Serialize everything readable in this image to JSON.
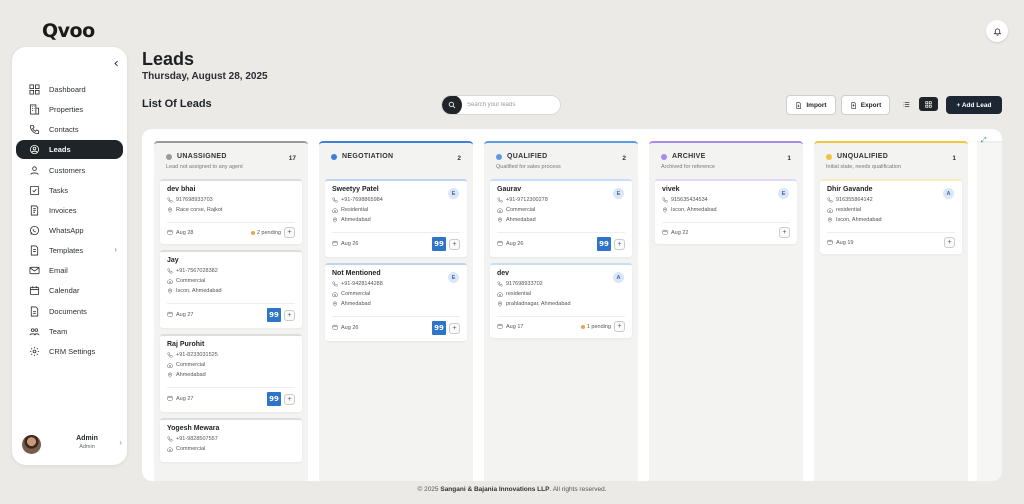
{
  "brand": {
    "logo": "Qvoo"
  },
  "sidebar": {
    "items": [
      {
        "label": "Dashboard",
        "icon": "dashboard-icon",
        "active": false
      },
      {
        "label": "Properties",
        "icon": "building-icon",
        "active": false
      },
      {
        "label": "Contacts",
        "icon": "phone-icon",
        "active": false
      },
      {
        "label": "Leads",
        "icon": "leads-icon",
        "active": true
      },
      {
        "label": "Customers",
        "icon": "user-icon",
        "active": false
      },
      {
        "label": "Tasks",
        "icon": "task-icon",
        "active": false
      },
      {
        "label": "Invoices",
        "icon": "invoice-icon",
        "active": false
      },
      {
        "label": "WhatsApp",
        "icon": "whatsapp-icon",
        "active": false
      },
      {
        "label": "Templates",
        "icon": "template-icon",
        "active": false
      },
      {
        "label": "Email",
        "icon": "email-icon",
        "active": false
      },
      {
        "label": "Calendar",
        "icon": "calendar-icon",
        "active": false
      },
      {
        "label": "Documents",
        "icon": "document-icon",
        "active": false
      },
      {
        "label": "Team",
        "icon": "team-icon",
        "active": false
      },
      {
        "label": "CRM Settings",
        "icon": "gear-icon",
        "active": false
      }
    ],
    "user": {
      "name": "Admin",
      "role": "Admin"
    }
  },
  "header": {
    "title": "Leads",
    "date": "Thursday, August 28, 2025",
    "list_title": "List Of Leads",
    "search_placeholder": "Search your leads",
    "import_label": "Import",
    "export_label": "Export",
    "add_label": "+ Add Lead"
  },
  "columns": [
    {
      "title": "UNASSIGNED",
      "count": "17",
      "desc": "Lead not assigned to any agent",
      "color": "#9a9a9a",
      "cards": [
        {
          "name": "dev bhai",
          "phone": "917698933703",
          "type": "",
          "location": "Race corse, Rajkot",
          "date": "Aug 28",
          "pending": "2 pending",
          "badge": "",
          "initial": ""
        },
        {
          "name": "Jay",
          "phone": "+91-7567028382",
          "type": "Commercial",
          "location": "Iscon, Ahmedabad",
          "date": "Aug 27",
          "pending": "",
          "badge": "99",
          "initial": ""
        },
        {
          "name": "Raj Purohit",
          "phone": "+91-8233031525",
          "type": "Commercial",
          "location": "Ahmedabad",
          "date": "Aug 27",
          "pending": "",
          "badge": "99",
          "initial": ""
        },
        {
          "name": "Yogesh Mewara",
          "phone": "+91-9828507557",
          "type": "Commercial",
          "location": "",
          "date": "",
          "pending": "",
          "badge": "",
          "initial": ""
        }
      ]
    },
    {
      "title": "NEGOTIATION",
      "count": "2",
      "desc": "",
      "color": "#3d7fd9",
      "cards": [
        {
          "name": "Sweetyy Patel",
          "phone": "+91-7698865984",
          "type": "Residential",
          "location": "Ahmedabad",
          "date": "Aug 26",
          "pending": "",
          "badge": "99",
          "initial": "E"
        },
        {
          "name": "Not Mentioned",
          "phone": "+91-9428144288",
          "type": "Commercial",
          "location": "Ahmedabad",
          "date": "Aug 26",
          "pending": "",
          "badge": "99",
          "initial": "E"
        }
      ]
    },
    {
      "title": "QUALIFIED",
      "count": "2",
      "desc": "Qualified for sales process",
      "color": "#5b9be6",
      "cards": [
        {
          "name": "Gaurav",
          "phone": "+91-9712300278",
          "type": "Commercial",
          "location": "Ahmedabad",
          "date": "Aug 26",
          "pending": "",
          "badge": "99",
          "initial": "E"
        },
        {
          "name": "dev",
          "phone": "917698933702",
          "type": "residential",
          "location": "prahladnagar, Ahmedabad",
          "date": "Aug 17",
          "pending": "1 pending",
          "badge": "",
          "initial": "A"
        }
      ]
    },
    {
      "title": "ARCHIVE",
      "count": "1",
      "desc": "Archived for reference",
      "color": "#a78be8",
      "cards": [
        {
          "name": "vivek",
          "phone": "915635434534",
          "type": "",
          "location": "Iscon, Ahmedabad",
          "date": "Aug 22",
          "pending": "",
          "badge": "",
          "initial": "E"
        }
      ]
    },
    {
      "title": "UNQUALIFIED",
      "count": "1",
      "desc": "Initial state, needs qualification",
      "color": "#f2c53a",
      "cards": [
        {
          "name": "Dhir Gavande",
          "phone": "916355864142",
          "type": "residential",
          "location": "Iscon, Ahmedabad",
          "date": "Aug 19",
          "pending": "",
          "badge": "",
          "initial": "A"
        }
      ]
    }
  ],
  "footer": {
    "prefix": "© 2025",
    "company": "Sangani & Bajania Innovations LLP",
    "suffix": ". All rights reserved."
  }
}
